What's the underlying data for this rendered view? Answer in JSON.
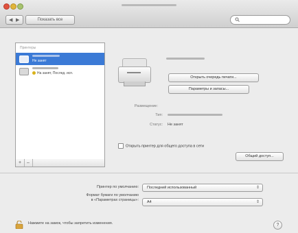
{
  "window": {
    "back_icon": "chevron-left-icon",
    "forward_icon": "chevron-right-icon",
    "show_all_label": "Показать все",
    "search_placeholder": "",
    "search_icon": "magnifier-icon"
  },
  "printers_list": {
    "header": "Принтеры",
    "items": [
      {
        "name": "",
        "status": "Не занят",
        "selected": true
      },
      {
        "name": "",
        "status": "На занят, Послед. исп.",
        "selected": false,
        "status_color": "#d9b21b"
      }
    ],
    "add_label": "+",
    "remove_label": "–"
  },
  "printer_detail": {
    "open_queue_label": "Открыть очередь печати...",
    "options_label": "Параметры и запасы...",
    "location_label": "Размещение:",
    "kind_label": "Тип:",
    "status_label": "Статус:",
    "status_value": "Не занят",
    "share_label": "Открыть принтер для общего доступа в сети",
    "share_settings_label": "Общий доступ..."
  },
  "defaults": {
    "default_printer_label": "Принтер по умолчанию:",
    "default_printer_value": "Последний использованный",
    "paper_size_label_line1": "Формат бумаги по умолчанию",
    "paper_size_label_line2": "в «Параметрах страницы»:",
    "paper_size_value": "А4"
  },
  "footer": {
    "lock_text": "Нажмите на замок, чтобы запретить изменения.",
    "help_label": "?"
  }
}
